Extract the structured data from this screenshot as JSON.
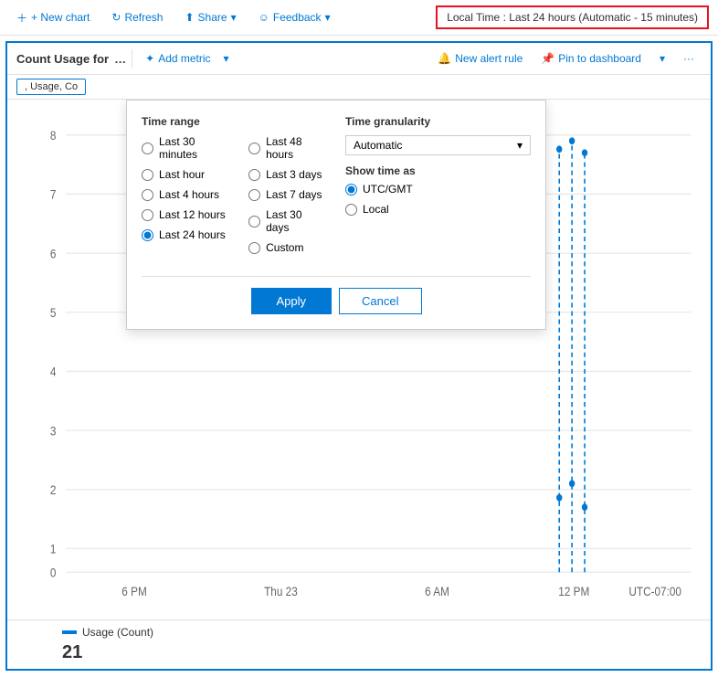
{
  "topbar": {
    "new_chart_label": "+ New chart",
    "refresh_label": "Refresh",
    "share_label": "Share",
    "feedback_label": "Feedback",
    "time_display": "Local Time : Last 24 hours (Automatic - 15 minutes)"
  },
  "chart": {
    "title": "Count Usage for",
    "add_metric_label": "Add metric",
    "new_alert_label": "New alert rule",
    "pin_dashboard_label": "Pin to dashboard",
    "filter_tag": ", Usage, Co"
  },
  "time_popup": {
    "header": "Time range",
    "granularity_header": "Time granularity",
    "granularity_value": "Automatic",
    "show_time_label": "Show time as",
    "options_left": [
      {
        "id": "r30min",
        "label": "Last 30 minutes",
        "selected": false
      },
      {
        "id": "r1hour",
        "label": "Last hour",
        "selected": false
      },
      {
        "id": "r4hours",
        "label": "Last 4 hours",
        "selected": false
      },
      {
        "id": "r12hours",
        "label": "Last 12 hours",
        "selected": false
      },
      {
        "id": "r24hours",
        "label": "Last 24 hours",
        "selected": true
      }
    ],
    "options_right": [
      {
        "id": "r48hours",
        "label": "Last 48 hours",
        "selected": false
      },
      {
        "id": "r3days",
        "label": "Last 3 days",
        "selected": false
      },
      {
        "id": "r7days",
        "label": "Last 7 days",
        "selected": false
      },
      {
        "id": "r30days",
        "label": "Last 30 days",
        "selected": false
      },
      {
        "id": "rcustom",
        "label": "Custom",
        "selected": false
      }
    ],
    "show_time_options": [
      {
        "id": "utc",
        "label": "UTC/GMT",
        "selected": true
      },
      {
        "id": "local",
        "label": "Local",
        "selected": false
      }
    ],
    "apply_label": "Apply",
    "cancel_label": "Cancel"
  },
  "chart_data": {
    "y_labels": [
      "8",
      "7",
      "6",
      "5",
      "4",
      "3",
      "2",
      "1",
      "0"
    ],
    "x_labels": [
      "6 PM",
      "Thu 23",
      "6 AM",
      "12 PM",
      "UTC-07:00"
    ],
    "legend_label": "Usage (Count)",
    "legend_value": "21"
  }
}
